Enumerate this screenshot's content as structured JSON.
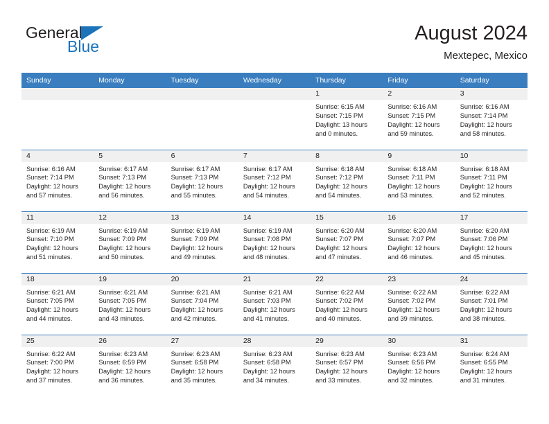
{
  "brand": {
    "name_part1": "General",
    "name_part2": "Blue",
    "triangle_color": "#1b73ba"
  },
  "header": {
    "title": "August 2024",
    "subtitle": "Mextepec, Mexico",
    "header_bg": "#3a7ebf",
    "daynum_bg": "#f0f0f0"
  },
  "weekday_headers": [
    "Sunday",
    "Monday",
    "Tuesday",
    "Wednesday",
    "Thursday",
    "Friday",
    "Saturday"
  ],
  "labels": {
    "sunrise_prefix": "Sunrise: ",
    "sunset_prefix": "Sunset: ",
    "daylight_prefix": "Daylight: "
  },
  "weeks": [
    [
      {
        "day": "",
        "sunrise": "",
        "sunset": "",
        "daylight_line1": "",
        "daylight_line2": ""
      },
      {
        "day": "",
        "sunrise": "",
        "sunset": "",
        "daylight_line1": "",
        "daylight_line2": ""
      },
      {
        "day": "",
        "sunrise": "",
        "sunset": "",
        "daylight_line1": "",
        "daylight_line2": ""
      },
      {
        "day": "",
        "sunrise": "",
        "sunset": "",
        "daylight_line1": "",
        "daylight_line2": ""
      },
      {
        "day": "1",
        "sunrise": "Sunrise: 6:15 AM",
        "sunset": "Sunset: 7:15 PM",
        "daylight_line1": "Daylight: 13 hours",
        "daylight_line2": "and 0 minutes."
      },
      {
        "day": "2",
        "sunrise": "Sunrise: 6:16 AM",
        "sunset": "Sunset: 7:15 PM",
        "daylight_line1": "Daylight: 12 hours",
        "daylight_line2": "and 59 minutes."
      },
      {
        "day": "3",
        "sunrise": "Sunrise: 6:16 AM",
        "sunset": "Sunset: 7:14 PM",
        "daylight_line1": "Daylight: 12 hours",
        "daylight_line2": "and 58 minutes."
      }
    ],
    [
      {
        "day": "4",
        "sunrise": "Sunrise: 6:16 AM",
        "sunset": "Sunset: 7:14 PM",
        "daylight_line1": "Daylight: 12 hours",
        "daylight_line2": "and 57 minutes."
      },
      {
        "day": "5",
        "sunrise": "Sunrise: 6:17 AM",
        "sunset": "Sunset: 7:13 PM",
        "daylight_line1": "Daylight: 12 hours",
        "daylight_line2": "and 56 minutes."
      },
      {
        "day": "6",
        "sunrise": "Sunrise: 6:17 AM",
        "sunset": "Sunset: 7:13 PM",
        "daylight_line1": "Daylight: 12 hours",
        "daylight_line2": "and 55 minutes."
      },
      {
        "day": "7",
        "sunrise": "Sunrise: 6:17 AM",
        "sunset": "Sunset: 7:12 PM",
        "daylight_line1": "Daylight: 12 hours",
        "daylight_line2": "and 54 minutes."
      },
      {
        "day": "8",
        "sunrise": "Sunrise: 6:18 AM",
        "sunset": "Sunset: 7:12 PM",
        "daylight_line1": "Daylight: 12 hours",
        "daylight_line2": "and 54 minutes."
      },
      {
        "day": "9",
        "sunrise": "Sunrise: 6:18 AM",
        "sunset": "Sunset: 7:11 PM",
        "daylight_line1": "Daylight: 12 hours",
        "daylight_line2": "and 53 minutes."
      },
      {
        "day": "10",
        "sunrise": "Sunrise: 6:18 AM",
        "sunset": "Sunset: 7:11 PM",
        "daylight_line1": "Daylight: 12 hours",
        "daylight_line2": "and 52 minutes."
      }
    ],
    [
      {
        "day": "11",
        "sunrise": "Sunrise: 6:19 AM",
        "sunset": "Sunset: 7:10 PM",
        "daylight_line1": "Daylight: 12 hours",
        "daylight_line2": "and 51 minutes."
      },
      {
        "day": "12",
        "sunrise": "Sunrise: 6:19 AM",
        "sunset": "Sunset: 7:09 PM",
        "daylight_line1": "Daylight: 12 hours",
        "daylight_line2": "and 50 minutes."
      },
      {
        "day": "13",
        "sunrise": "Sunrise: 6:19 AM",
        "sunset": "Sunset: 7:09 PM",
        "daylight_line1": "Daylight: 12 hours",
        "daylight_line2": "and 49 minutes."
      },
      {
        "day": "14",
        "sunrise": "Sunrise: 6:19 AM",
        "sunset": "Sunset: 7:08 PM",
        "daylight_line1": "Daylight: 12 hours",
        "daylight_line2": "and 48 minutes."
      },
      {
        "day": "15",
        "sunrise": "Sunrise: 6:20 AM",
        "sunset": "Sunset: 7:07 PM",
        "daylight_line1": "Daylight: 12 hours",
        "daylight_line2": "and 47 minutes."
      },
      {
        "day": "16",
        "sunrise": "Sunrise: 6:20 AM",
        "sunset": "Sunset: 7:07 PM",
        "daylight_line1": "Daylight: 12 hours",
        "daylight_line2": "and 46 minutes."
      },
      {
        "day": "17",
        "sunrise": "Sunrise: 6:20 AM",
        "sunset": "Sunset: 7:06 PM",
        "daylight_line1": "Daylight: 12 hours",
        "daylight_line2": "and 45 minutes."
      }
    ],
    [
      {
        "day": "18",
        "sunrise": "Sunrise: 6:21 AM",
        "sunset": "Sunset: 7:05 PM",
        "daylight_line1": "Daylight: 12 hours",
        "daylight_line2": "and 44 minutes."
      },
      {
        "day": "19",
        "sunrise": "Sunrise: 6:21 AM",
        "sunset": "Sunset: 7:05 PM",
        "daylight_line1": "Daylight: 12 hours",
        "daylight_line2": "and 43 minutes."
      },
      {
        "day": "20",
        "sunrise": "Sunrise: 6:21 AM",
        "sunset": "Sunset: 7:04 PM",
        "daylight_line1": "Daylight: 12 hours",
        "daylight_line2": "and 42 minutes."
      },
      {
        "day": "21",
        "sunrise": "Sunrise: 6:21 AM",
        "sunset": "Sunset: 7:03 PM",
        "daylight_line1": "Daylight: 12 hours",
        "daylight_line2": "and 41 minutes."
      },
      {
        "day": "22",
        "sunrise": "Sunrise: 6:22 AM",
        "sunset": "Sunset: 7:02 PM",
        "daylight_line1": "Daylight: 12 hours",
        "daylight_line2": "and 40 minutes."
      },
      {
        "day": "23",
        "sunrise": "Sunrise: 6:22 AM",
        "sunset": "Sunset: 7:02 PM",
        "daylight_line1": "Daylight: 12 hours",
        "daylight_line2": "and 39 minutes."
      },
      {
        "day": "24",
        "sunrise": "Sunrise: 6:22 AM",
        "sunset": "Sunset: 7:01 PM",
        "daylight_line1": "Daylight: 12 hours",
        "daylight_line2": "and 38 minutes."
      }
    ],
    [
      {
        "day": "25",
        "sunrise": "Sunrise: 6:22 AM",
        "sunset": "Sunset: 7:00 PM",
        "daylight_line1": "Daylight: 12 hours",
        "daylight_line2": "and 37 minutes."
      },
      {
        "day": "26",
        "sunrise": "Sunrise: 6:23 AM",
        "sunset": "Sunset: 6:59 PM",
        "daylight_line1": "Daylight: 12 hours",
        "daylight_line2": "and 36 minutes."
      },
      {
        "day": "27",
        "sunrise": "Sunrise: 6:23 AM",
        "sunset": "Sunset: 6:58 PM",
        "daylight_line1": "Daylight: 12 hours",
        "daylight_line2": "and 35 minutes."
      },
      {
        "day": "28",
        "sunrise": "Sunrise: 6:23 AM",
        "sunset": "Sunset: 6:58 PM",
        "daylight_line1": "Daylight: 12 hours",
        "daylight_line2": "and 34 minutes."
      },
      {
        "day": "29",
        "sunrise": "Sunrise: 6:23 AM",
        "sunset": "Sunset: 6:57 PM",
        "daylight_line1": "Daylight: 12 hours",
        "daylight_line2": "and 33 minutes."
      },
      {
        "day": "30",
        "sunrise": "Sunrise: 6:23 AM",
        "sunset": "Sunset: 6:56 PM",
        "daylight_line1": "Daylight: 12 hours",
        "daylight_line2": "and 32 minutes."
      },
      {
        "day": "31",
        "sunrise": "Sunrise: 6:24 AM",
        "sunset": "Sunset: 6:55 PM",
        "daylight_line1": "Daylight: 12 hours",
        "daylight_line2": "and 31 minutes."
      }
    ]
  ]
}
